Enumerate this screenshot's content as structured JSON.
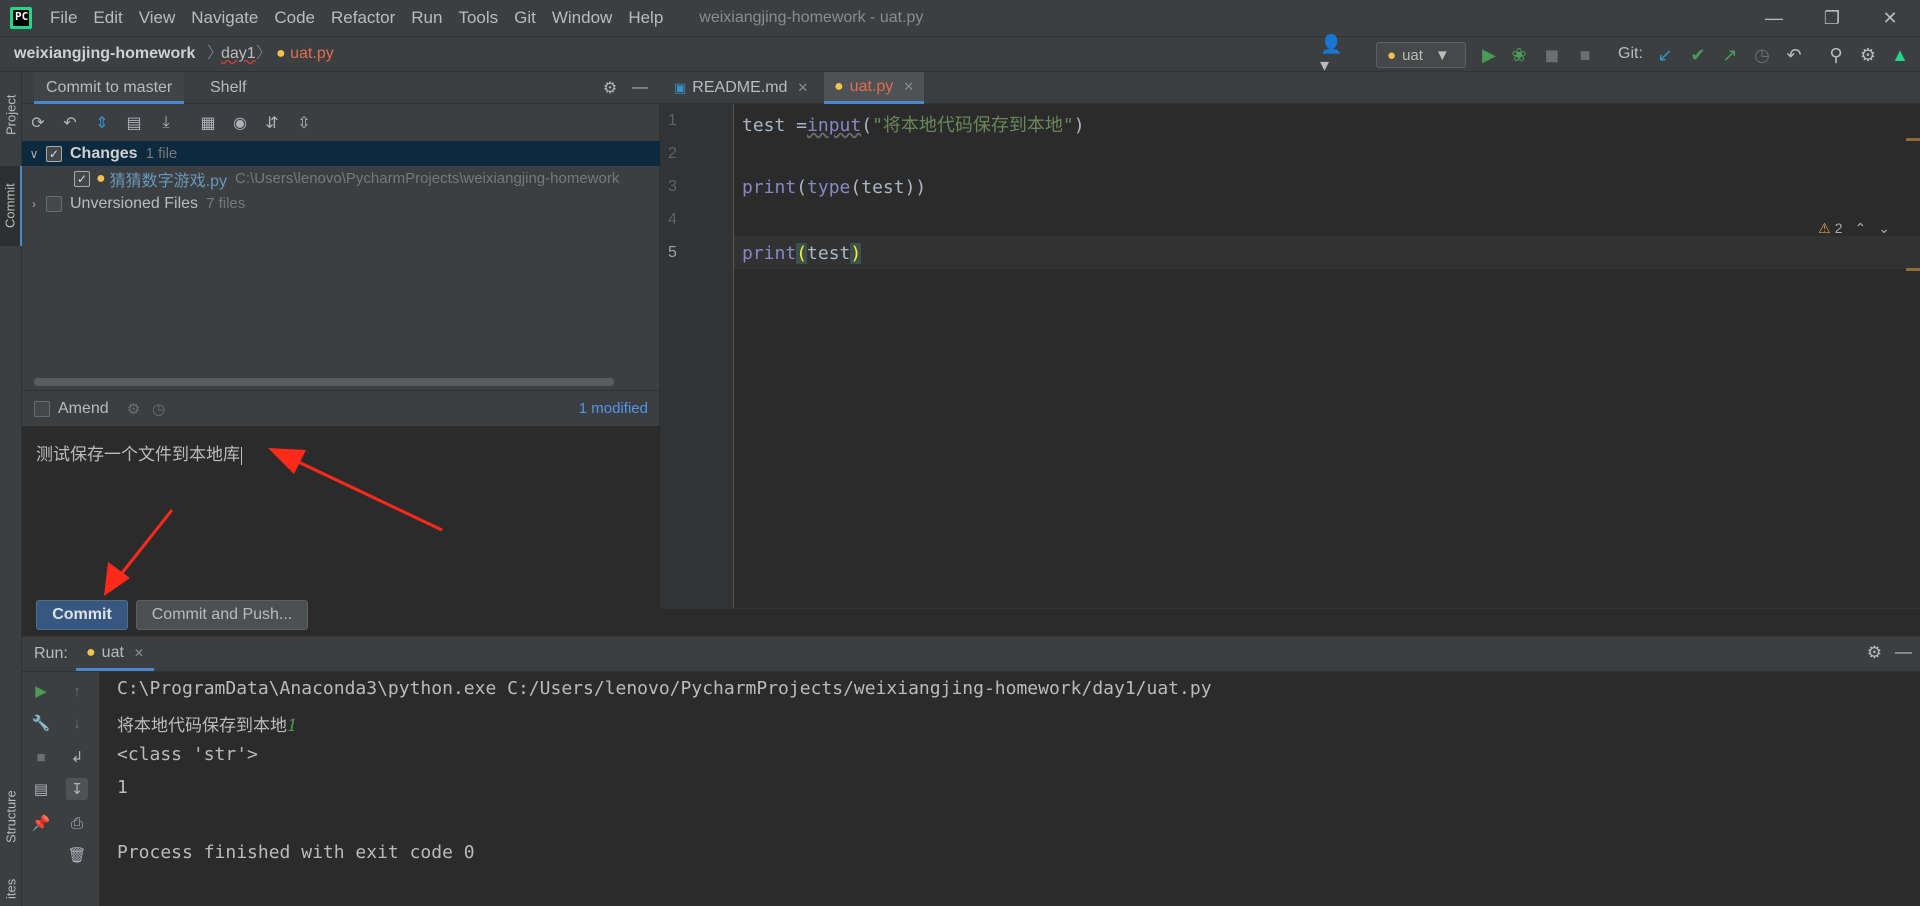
{
  "titlebar": {
    "menu": [
      "File",
      "Edit",
      "View",
      "Navigate",
      "Code",
      "Refactor",
      "Run",
      "Tools",
      "Git",
      "Window",
      "Help"
    ],
    "window_title": "weixiangjing-homework - uat.py"
  },
  "navbar": {
    "project": "weixiangjing-homework",
    "folder": "day1",
    "file": "uat.py",
    "run_config": "uat",
    "git_label": "Git:"
  },
  "left_strip": {
    "project_tab": "Project",
    "commit_tab": "Commit",
    "structure_tab": "Structure",
    "favorites_tab": "ites"
  },
  "commit_panel": {
    "tab_commit": "Commit to master",
    "tab_shelf": "Shelf",
    "changes_label": "Changes",
    "changes_count": "1 file",
    "file_name": "猜猜数字游戏.py",
    "file_path": "C:\\Users\\lenovo\\PycharmProjects\\weixiangjing-homework",
    "unversioned_label": "Unversioned Files",
    "unversioned_count": "7 files",
    "amend_label": "Amend",
    "modified_status": "1 modified",
    "message": "测试保存一个文件到本地库",
    "commit_button": "Commit",
    "commit_push_button": "Commit and Push..."
  },
  "editor": {
    "tabs": [
      {
        "label": "README.md"
      },
      {
        "label": "uat.py"
      }
    ],
    "line_numbers": [
      "1",
      "2",
      "3",
      "4",
      "5"
    ],
    "code": {
      "l1_a": "test =",
      "l1_fn": "input",
      "l1_b": "(",
      "l1_str": "\"将本地代码保存到本地\"",
      "l1_c": ")",
      "l3_fn1": "print",
      "l3_b": "(",
      "l3_fn2": "type",
      "l3_c": "(test))",
      "l5_fn": "print",
      "l5_open": "(",
      "l5_arg": "test",
      "l5_close": ")"
    },
    "warnings": "2"
  },
  "run_panel": {
    "label": "Run:",
    "tab": "uat",
    "lines": [
      "C:\\ProgramData\\Anaconda3\\python.exe C:/Users/lenovo/PycharmProjects/weixiangjing-homework/day1/uat.py",
      "将本地代码保存到本地",
      "<class 'str'>",
      "1",
      "",
      "Process finished with exit code 0"
    ],
    "input_echo": "1"
  },
  "colors": {
    "accent": "#4a88c7",
    "annotation": "#ff2a1a",
    "run_green": "#499c54",
    "file_blue": "#6897bb"
  }
}
